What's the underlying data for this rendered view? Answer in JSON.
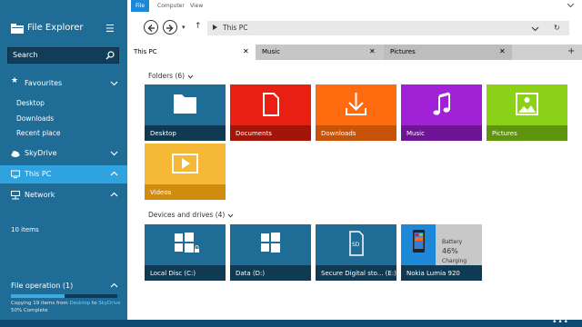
{
  "app": {
    "title": "File Explorer",
    "icon": "folder-stack-icon",
    "menu_icon": "hamburger-icon"
  },
  "search": {
    "placeholder": "Search"
  },
  "sidebar": {
    "favourites": {
      "label": "Favourites",
      "items": [
        "Desktop",
        "Downloads",
        "Recent place"
      ]
    },
    "skydrive": {
      "label": "SkyDrive"
    },
    "this_pc": {
      "label": "This PC"
    },
    "network": {
      "label": "Network"
    },
    "items_count": "10 items"
  },
  "file_operation": {
    "title": "File operation (1)",
    "progress": 0.5,
    "line1_prefix": "Copying 19 items from ",
    "line1_src": "Desktop",
    "line1_mid": " to ",
    "line1_dst": "SkyDrive",
    "line2": "50% Complete"
  },
  "menu_tabs": [
    "File",
    "Computer",
    "View"
  ],
  "address": {
    "path": "This PC"
  },
  "tabs": [
    {
      "label": "This PC"
    },
    {
      "label": "Music"
    },
    {
      "label": "Pictures"
    }
  ],
  "folders": {
    "header": "Folders (6)",
    "items": [
      "Desktop",
      "Documents",
      "Downloads",
      "Music",
      "Pictures",
      "Videos"
    ]
  },
  "devices": {
    "header": "Devices and drives (4)",
    "items": [
      "Local Disc (C:)",
      "Data (D:)",
      "Secure Digital sto... (E:)",
      "Nokia Lumia 920"
    ],
    "phone": {
      "battery_label": "Battery",
      "battery_pct": "46%",
      "battery_status": "Charging"
    },
    "sd_label": "SD"
  },
  "bottom_bar": {
    "more": "•••"
  },
  "colors": {
    "sidebar": "#1f6c97",
    "active": "#2fa3e0",
    "accent": "#1e88d8"
  }
}
